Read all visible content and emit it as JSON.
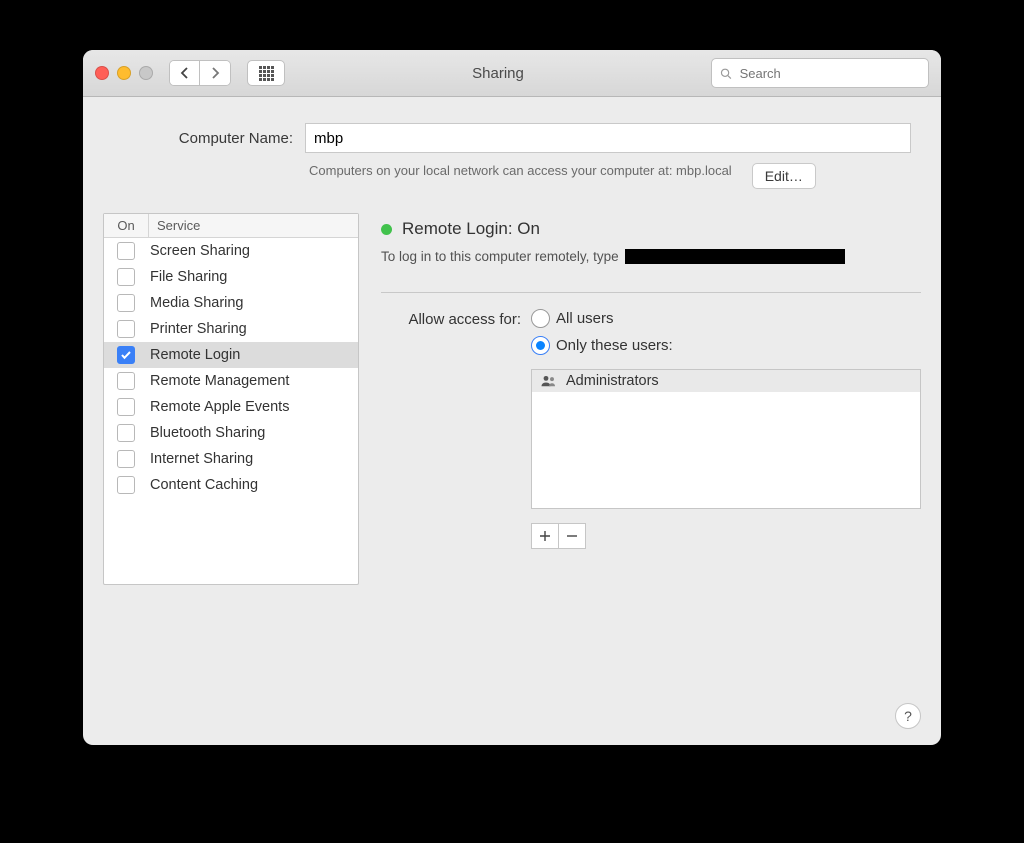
{
  "title": "Sharing",
  "search": {
    "placeholder": "Search"
  },
  "computer_name": {
    "label": "Computer Name:",
    "value": "mbp",
    "description": "Computers on your local network can access your computer at: mbp.local",
    "edit_label": "Edit…"
  },
  "services": {
    "header_on": "On",
    "header_service": "Service",
    "items": [
      {
        "label": "Screen Sharing",
        "checked": false,
        "selected": false
      },
      {
        "label": "File Sharing",
        "checked": false,
        "selected": false
      },
      {
        "label": "Media Sharing",
        "checked": false,
        "selected": false
      },
      {
        "label": "Printer Sharing",
        "checked": false,
        "selected": false
      },
      {
        "label": "Remote Login",
        "checked": true,
        "selected": true
      },
      {
        "label": "Remote Management",
        "checked": false,
        "selected": false
      },
      {
        "label": "Remote Apple Events",
        "checked": false,
        "selected": false
      },
      {
        "label": "Bluetooth Sharing",
        "checked": false,
        "selected": false
      },
      {
        "label": "Internet Sharing",
        "checked": false,
        "selected": false
      },
      {
        "label": "Content Caching",
        "checked": false,
        "selected": false
      }
    ]
  },
  "detail": {
    "status_title": "Remote Login: On",
    "status_color": "#41c24c",
    "instruction": "To log in to this computer remotely, type"
  },
  "access": {
    "label": "Allow access for:",
    "options": {
      "all": "All users",
      "only": "Only these users:"
    },
    "selected": "only",
    "users": [
      "Administrators"
    ]
  },
  "help_label": "?"
}
